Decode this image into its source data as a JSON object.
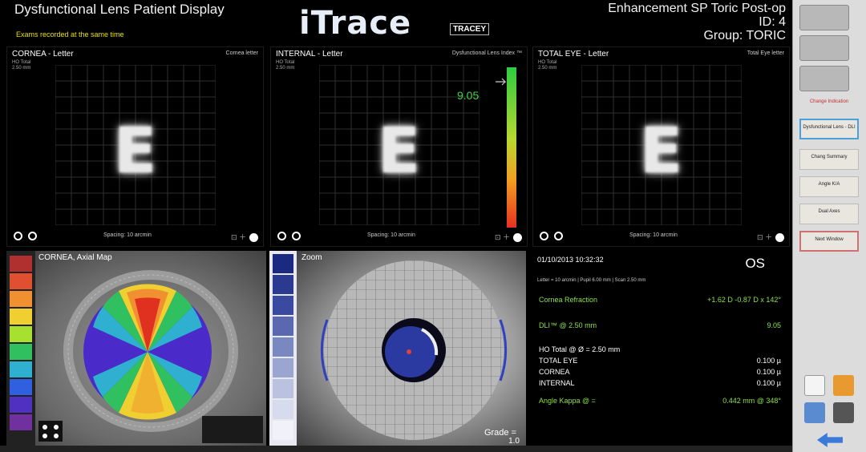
{
  "header": {
    "title": "Dysfunctional Lens Patient Display",
    "subtitle": "Exams recorded at the same time",
    "logo": "iTrace",
    "logo_badge": "TRACEY",
    "patient": "Enhancement SP Toric Post-op",
    "id": "ID: 4",
    "group": "Group: TORIC"
  },
  "panels": [
    {
      "title": "CORNEA - Letter",
      "right_label": "Cornea letter",
      "meta": "HO Total\n2.50 mm",
      "spacing": "Spacing: 10 arcmin"
    },
    {
      "title": "INTERNAL - Letter",
      "right_label": "Dysfunctional Lens Index ™",
      "meta": "HO Total\n2.50 mm",
      "spacing": "Spacing: 10 arcmin",
      "value": "9.05"
    },
    {
      "title": "TOTAL EYE - Letter",
      "right_label": "Total Eye letter",
      "meta": "HO Total\n2.50 mm",
      "spacing": "Spacing: 10 arcmin"
    }
  ],
  "bottom": {
    "topo_title": "CORNEA, Axial Map",
    "pupil_title": "Zoom",
    "grade_label": "Grade =",
    "grade_value": "1.0",
    "date": "01/10/2013  10:32:32",
    "eye": "OS",
    "info_line": "Letter = 10 arcmin  |  Pupil 6.00 mm  |  Scan 2.50 mm",
    "rows": [
      {
        "label": "Cornea Refraction",
        "value": "+1.62 D  -0.87 D x 142°",
        "green": true
      },
      {
        "label": "DLI™ @ 2.50 mm",
        "value": "9.05",
        "green": true
      },
      {
        "label": "HO Total @ Ø = 2.50 mm",
        "value": "",
        "green": false
      },
      {
        "label": "TOTAL EYE",
        "value": "0.100 µ",
        "green": false
      },
      {
        "label": "CORNEA",
        "value": "0.100 µ",
        "green": false
      },
      {
        "label": "INTERNAL",
        "value": "0.100 µ",
        "green": false
      },
      {
        "label": "Angle Kappa @ =",
        "value": "0.442 mm @ 348°",
        "green": true
      }
    ]
  },
  "sidebar": {
    "link": "Change Indication",
    "buttons": [
      "Dysfunctional Lens - DLI",
      "Chang Summary",
      "Angle K/A",
      "Dual Axes",
      "Next Window"
    ]
  },
  "colors": {
    "accent_green": "#8ee04a",
    "subtitle_yellow": "#e8e000",
    "active_border": "#4aa0d8"
  }
}
